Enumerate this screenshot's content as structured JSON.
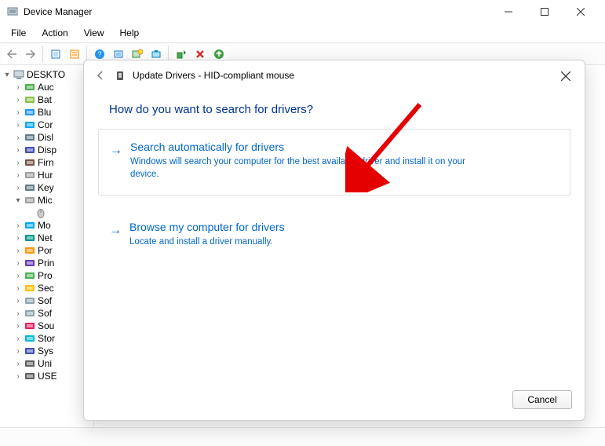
{
  "titlebar": {
    "title": "Device Manager"
  },
  "menubar": {
    "items": [
      "File",
      "Action",
      "View",
      "Help"
    ]
  },
  "tree": {
    "root": "DESKTO",
    "nodes": [
      {
        "label": "Auc",
        "icon": "speaker"
      },
      {
        "label": "Bat",
        "icon": "battery"
      },
      {
        "label": "Blu",
        "icon": "bluetooth"
      },
      {
        "label": "Cor",
        "icon": "monitor"
      },
      {
        "label": "Disl",
        "icon": "disk"
      },
      {
        "label": "Disp",
        "icon": "display"
      },
      {
        "label": "Firn",
        "icon": "chip"
      },
      {
        "label": "Hur",
        "icon": "hid"
      },
      {
        "label": "Key",
        "icon": "keyboard"
      },
      {
        "label": "Mic",
        "icon": "mouse",
        "expanded": true,
        "child": ""
      },
      {
        "label": "Mo",
        "icon": "monitor"
      },
      {
        "label": "Net",
        "icon": "network"
      },
      {
        "label": "Por",
        "icon": "port"
      },
      {
        "label": "Prin",
        "icon": "printer"
      },
      {
        "label": "Pro",
        "icon": "cpu"
      },
      {
        "label": "Sec",
        "icon": "key"
      },
      {
        "label": "Sof",
        "icon": "soft"
      },
      {
        "label": "Sof",
        "icon": "soft"
      },
      {
        "label": "Sou",
        "icon": "sound"
      },
      {
        "label": "Stor",
        "icon": "storage"
      },
      {
        "label": "Sys",
        "icon": "system"
      },
      {
        "label": "Uni",
        "icon": "usb"
      },
      {
        "label": "USE",
        "icon": "usb"
      }
    ]
  },
  "dialog": {
    "title": "Update Drivers - HID-compliant mouse",
    "heading": "How do you want to search for drivers?",
    "options": [
      {
        "title": "Search automatically for drivers",
        "desc": "Windows will search your computer for the best available driver and install it on your device."
      },
      {
        "title": "Browse my computer for drivers",
        "desc": "Locate and install a driver manually."
      }
    ],
    "cancel": "Cancel"
  }
}
